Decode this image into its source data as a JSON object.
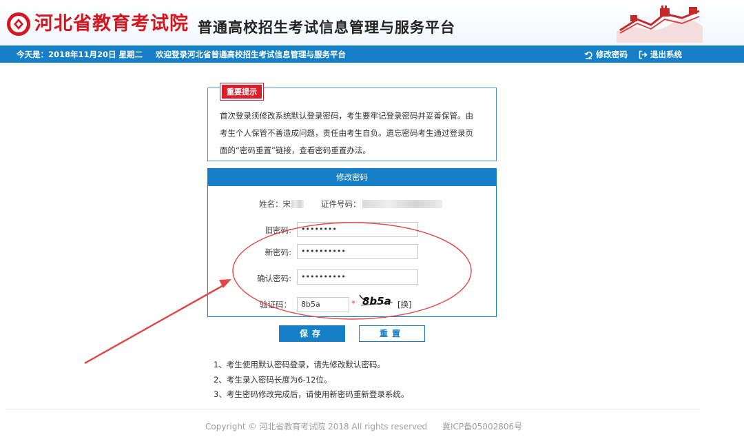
{
  "header": {
    "org_name": "河北省教育考试院",
    "platform_name": "普通高校招生考试信息管理与服务平台"
  },
  "navbar": {
    "date_text": "今天是：2018年11月20日 星期二",
    "welcome_text": "欢迎登录河北省普通高校招生考试信息管理与服务平台",
    "change_password_link": "修改密码",
    "logout_link": "退出系统"
  },
  "notice": {
    "tag": "重要提示",
    "lines": [
      "首次登录须修改系统默认登录密码，考生要牢记登录密码并妥善保管。由",
      "考生个人保管不善造成问题，责任由考生自负。遗忘密码考生通过登录页",
      "面的“密码重置”链接，查看密码重置办法。"
    ]
  },
  "form": {
    "title": "修改密码",
    "name_label": "姓名：宋",
    "id_label": "证件号码：",
    "old_password_label": "旧密码:",
    "old_password_value": "••••••••",
    "new_password_label": "新密码:",
    "new_password_value": "••••••••••",
    "confirm_password_label": "确认密码:",
    "confirm_password_value": "••••••••••",
    "captcha_label": "验证码：",
    "captcha_value": "8b5a",
    "captcha_star": "*",
    "captcha_image_text": "8b5a",
    "refresh_label": "[换]"
  },
  "buttons": {
    "save_label": "保存",
    "reset_label": "重置"
  },
  "notes": [
    "1、考生使用默认密码登录，请先修改默认密码。",
    "2、考生录入密码长度为6-12位。",
    "3、考生密码修改完成后，请使用新密码重新登录系统。"
  ],
  "footer": {
    "copyright": "Copyright © 河北省教育考试院 2018 All rights reserved",
    "icp": "冀ICP备05002806号"
  },
  "colors": {
    "brand_red": "#d4161f",
    "nav_blue": "#1580c7",
    "annotation_red": "#e04848"
  }
}
